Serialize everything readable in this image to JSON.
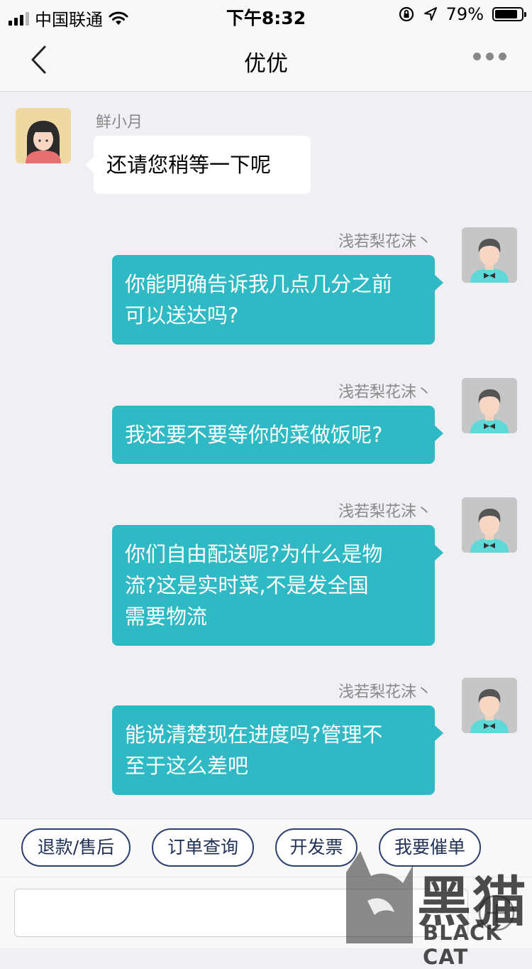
{
  "status_bar": {
    "carrier": "中国联通",
    "time": "下午8:32",
    "battery_percent": "79%",
    "battery_level": 0.79,
    "icons": [
      "signal-icon",
      "wifi-icon",
      "rotation-lock-icon",
      "location-arrow-icon",
      "battery-icon"
    ]
  },
  "nav": {
    "title": "优优",
    "back_icon": "chevron-left-icon",
    "more_icon": "more-dots-icon"
  },
  "messages": [
    {
      "side": "left",
      "name": "鲜小月",
      "lines": [
        "还请您稍等一下呢"
      ]
    },
    {
      "side": "right",
      "name": "浅若梨花沫丶",
      "lines": [
        "你能明确告诉我几点几分之前",
        "可以送达吗?"
      ]
    },
    {
      "side": "right",
      "name": "浅若梨花沫丶",
      "lines": [
        "我还要不要等你的菜做饭呢?"
      ]
    },
    {
      "side": "right",
      "name": "浅若梨花沫丶",
      "lines": [
        "你们自由配送呢?为什么是物",
        "流?这是实时菜,不是发全国",
        "需要物流"
      ]
    },
    {
      "side": "right",
      "name": "浅若梨花沫丶",
      "lines": [
        "能说清楚现在进度吗?管理不",
        "至于这么差吧"
      ]
    }
  ],
  "quick_actions": [
    "退款/售后",
    "订单查询",
    "开发票",
    "我要催单"
  ],
  "input": {
    "placeholder": "",
    "plus_icon": "plus-circle-icon"
  },
  "watermark": {
    "cn": "黑猫",
    "en": "BLACK CAT"
  },
  "colors": {
    "accent": "#2fb9c4",
    "button_border": "#2e3f6e",
    "background": "#efeff4"
  }
}
